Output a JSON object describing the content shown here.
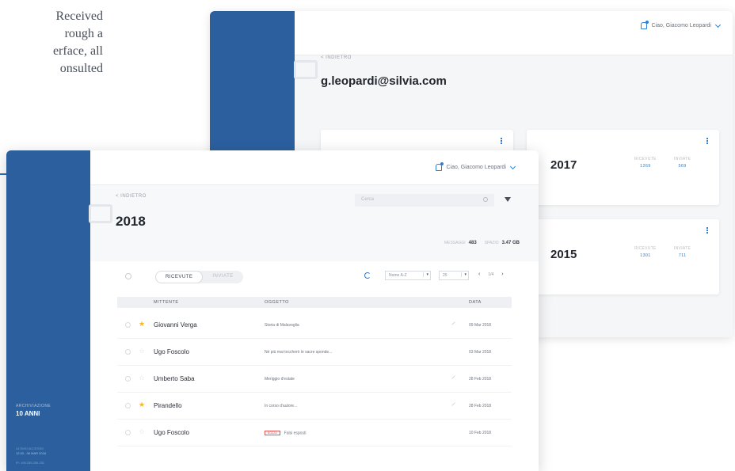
{
  "copy": {
    "lines": [
      "Received",
      "rough a",
      "erface, all",
      "onsulted"
    ]
  },
  "back_window": {
    "user_name": "Ciao, Giacomo Leopardi",
    "breadcrumb": "< INDIETRO",
    "email": "g.leopardi@silvia.com",
    "cards": [
      {
        "year": "",
        "received_label": "",
        "received": "",
        "sent_label": "",
        "sent": ""
      },
      {
        "year": "2017",
        "received_label": "RICEVUTE",
        "received": "1269",
        "sent_label": "INVIATE",
        "sent": "569"
      },
      {
        "year": "2015",
        "received_label": "RICEVUTE",
        "received": "1301",
        "sent_label": "INVIATE",
        "sent": "711"
      }
    ]
  },
  "front_window": {
    "user_name": "Ciao, Giacomo Leopardi",
    "breadcrumb": "< INDIETRO",
    "title": "2018",
    "search_placeholder": "Cerca",
    "storage": {
      "messages_label": "MESSAGGI",
      "messages": "483",
      "space_label": "SPAZIO",
      "space": "3.47 GB"
    },
    "sidebar": {
      "archive_label": "ARCHIVIAZIONE",
      "archive_value": "10 ANNI",
      "last_access_label": "ULTIMO ACCESSO",
      "last_access_value": "12:30 - 06 MAR 2018",
      "ip": "IP: 195.255.255.251"
    },
    "tabs": [
      {
        "label": "RICEVUTE",
        "active": true
      },
      {
        "label": "INVIATE",
        "active": false
      }
    ],
    "sort": {
      "value": "Nome A-Z",
      "arrow": "▾"
    },
    "per_page": {
      "value": "25",
      "arrow": "▾"
    },
    "pager": {
      "prev": "‹",
      "page": "1/4",
      "next": "›"
    },
    "columns": {
      "sender": "MITTENTE",
      "subject": "OGGETTO",
      "date": "DATA"
    },
    "rows": [
      {
        "sender": "Giovanni Verga",
        "subject": "Storia di Malavoglia",
        "date": "09 Mar 2018",
        "starred": true,
        "attachment": true,
        "tag": ""
      },
      {
        "sender": "Ugo Foscolo",
        "subject": "Né più mai toccherò le sacre sponde...",
        "date": "03 Mar 2018",
        "starred": false,
        "attachment": false,
        "tag": ""
      },
      {
        "sender": "Umberto Saba",
        "subject": "Meriggio d'estate",
        "date": "28 Feb 2018",
        "starred": false,
        "attachment": true,
        "tag": ""
      },
      {
        "sender": "Pirandello",
        "subject": "In corso d'autore...",
        "date": "28 Feb 2018",
        "starred": true,
        "attachment": true,
        "tag": ""
      },
      {
        "sender": "Ugo Foscolo",
        "subject": "Falsi esposti",
        "date": "10 Feb 2018",
        "starred": false,
        "attachment": false,
        "tag": "BOZZA"
      }
    ]
  },
  "colors": {
    "sidebar": "#2b5f9e",
    "accent": "#2d7fd3",
    "star": "#f5b62d",
    "tag": "#e05555"
  }
}
